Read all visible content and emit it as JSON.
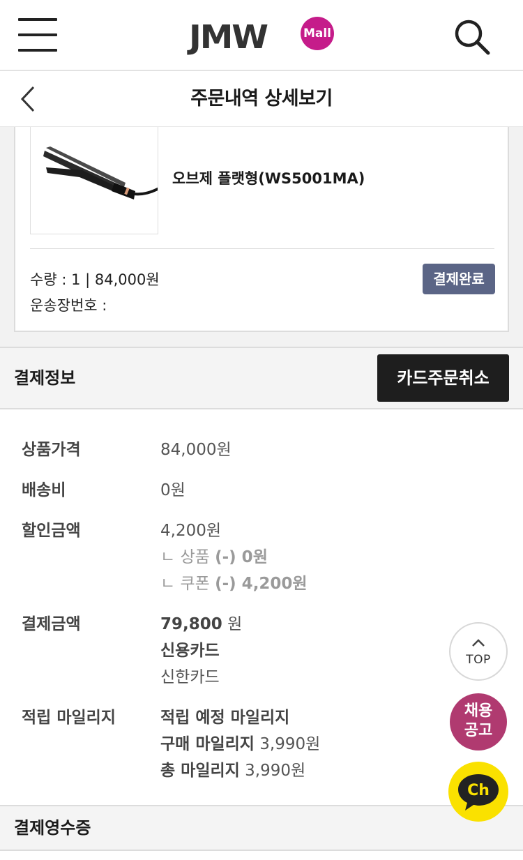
{
  "header": {
    "logo_text": "JMW",
    "logo_badge": "Mall",
    "menu_icon": "hamburger-menu-icon",
    "search_icon": "search-icon"
  },
  "subheader": {
    "title": "주문내역 상세보기",
    "back_icon": "chevron-left-icon"
  },
  "order_item": {
    "product_name": "오브제 플랫형(WS5001MA)",
    "quantity_line": "수량 : 1 | 84,000원",
    "tracking_line": "운송장번호 :",
    "status": "결제완료",
    "status_color": "#5b6586"
  },
  "payment_section": {
    "title": "결제정보",
    "cancel_button": "카드주문취소"
  },
  "details": {
    "price_label": "상품가격",
    "price_value": "84,000원",
    "shipping_label": "배송비",
    "shipping_value": "0원",
    "discount_label": "할인금액",
    "discount_value": "4,200원",
    "discount_product_prefix": "ㄴ 상품 ",
    "discount_product_value": "(-) 0원",
    "discount_coupon_prefix": "ㄴ 쿠폰 ",
    "discount_coupon_value": "(-) 4,200원",
    "paid_label": "결제금액",
    "paid_amount": "79,800",
    "paid_unit": " 원",
    "paid_method": "신용카드",
    "paid_card": "신한카드",
    "mileage_label": "적립 마일리지",
    "mileage_heading": "적립 예정 마일리지",
    "mileage_purchase_label": "구매 마일리지",
    "mileage_purchase_value": " 3,990원",
    "mileage_total_label": "총 마일리지",
    "mileage_total_value": " 3,990원"
  },
  "receipt_section": {
    "title": "결제영수증"
  },
  "floating": {
    "top_label": "TOP",
    "recruit_line1": "채용",
    "recruit_line2": "공고",
    "recruit_color": "#b03a70",
    "chat_label": "Ch",
    "chat_color": "#fae100"
  }
}
